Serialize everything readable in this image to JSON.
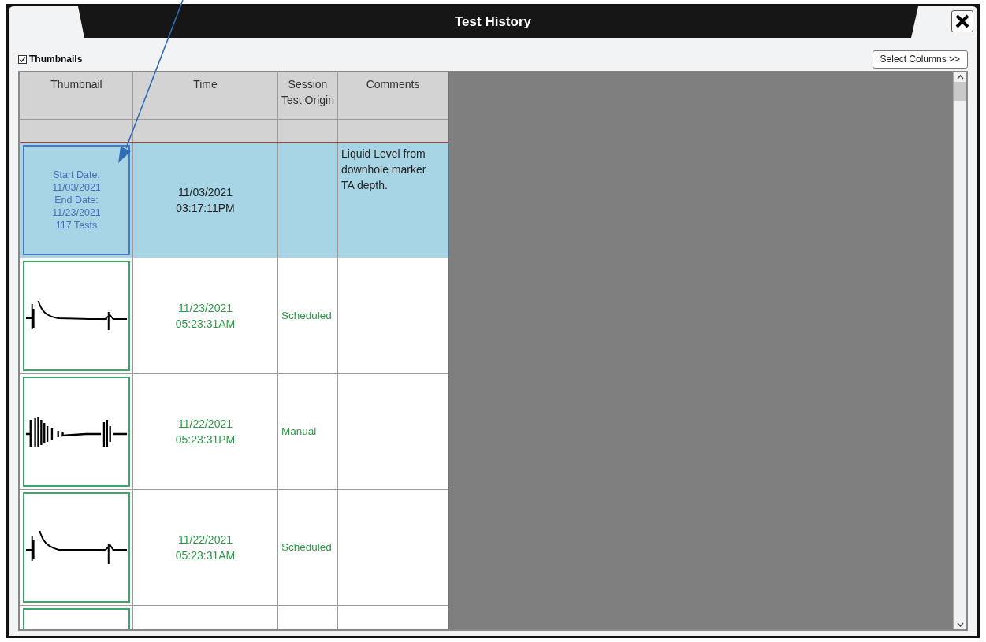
{
  "window": {
    "title": "Test History"
  },
  "thumbnails_toggle": {
    "label": "Thumbnails",
    "checked": true
  },
  "select_columns_button": "Select Columns >>",
  "table": {
    "columns": [
      {
        "label": "Thumbnail"
      },
      {
        "label": "Time"
      },
      {
        "label": "Session Test Origin"
      },
      {
        "label": "Comments"
      }
    ],
    "rows": [
      {
        "kind": "summary",
        "selected": true,
        "summary_lines": [
          "Start Date:",
          "11/03/2021",
          "End Date:",
          "11/23/2021",
          "117 Tests"
        ],
        "time": [
          "11/03/2021",
          "03:17:11PM"
        ],
        "comments": "Liquid Level from downhole marker TA depth."
      },
      {
        "kind": "test",
        "selected": false,
        "time": [
          "11/23/2021",
          "05:23:31AM"
        ],
        "origin": "Scheduled"
      },
      {
        "kind": "test",
        "selected": false,
        "time": [
          "11/22/2021",
          "05:23:31PM"
        ],
        "origin": "Manual"
      },
      {
        "kind": "test",
        "selected": false,
        "time": [
          "11/22/2021",
          "05:23:31AM"
        ],
        "origin": "Scheduled"
      },
      {
        "kind": "blank",
        "selected": false
      }
    ]
  }
}
